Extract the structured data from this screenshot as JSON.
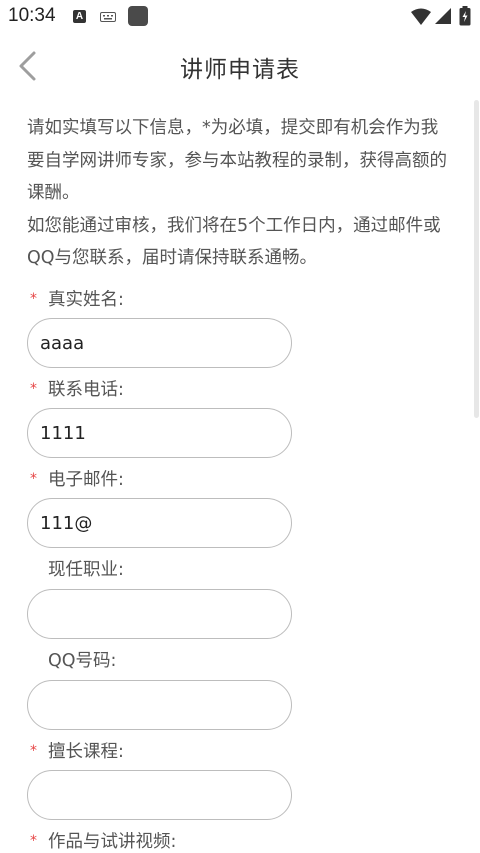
{
  "status_bar": {
    "time": "10:34",
    "notification_icon_letter": "A"
  },
  "header": {
    "title": "讲师申请表"
  },
  "intro": {
    "paragraph1": "请如实填写以下信息，*为必填，提交即有机会作为我要自学网讲师专家，参与本站教程的录制，获得高额的课酬。",
    "paragraph2": "如您能通过审核，我们将在5个工作日内，通过邮件或QQ与您联系，届时请保持联系通畅。"
  },
  "form": {
    "required_mark": "*",
    "fields": [
      {
        "label": "真实姓名:",
        "required": true,
        "value": "aaaa"
      },
      {
        "label": "联系电话:",
        "required": true,
        "value": "1111"
      },
      {
        "label": "电子邮件:",
        "required": true,
        "value": "111@"
      },
      {
        "label": "现任职业:",
        "required": false,
        "value": ""
      },
      {
        "label": "QQ号码:",
        "required": false,
        "value": ""
      },
      {
        "label": "擅长课程:",
        "required": true,
        "value": ""
      },
      {
        "label": "作品与试讲视频:",
        "required": true
      }
    ]
  },
  "colors": {
    "required": "#e64545",
    "text": "#555555",
    "border": "#bdbdbd"
  }
}
